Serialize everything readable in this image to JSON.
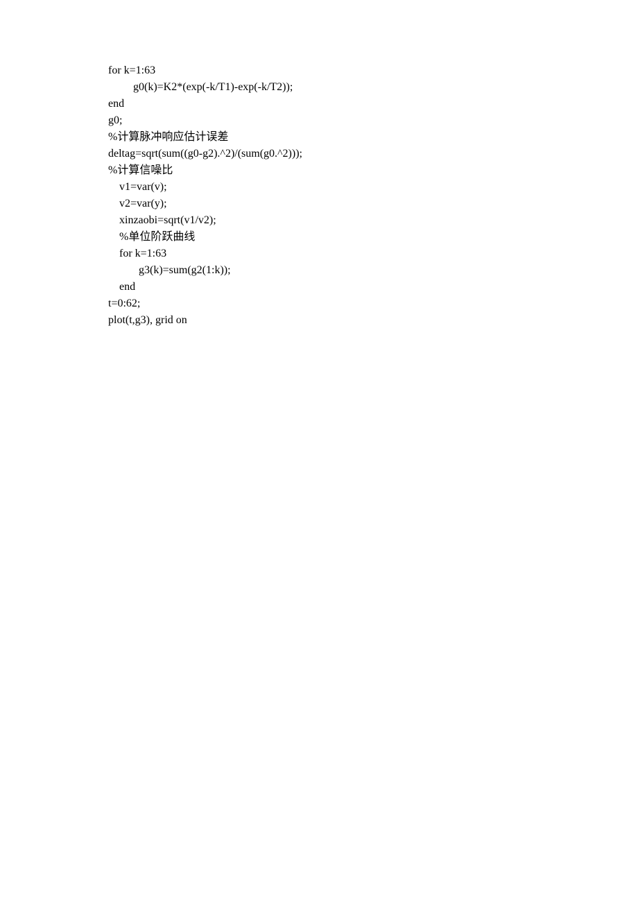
{
  "lines": [
    {
      "cls": "",
      "text": "for k=1:63"
    },
    {
      "cls": "indent1",
      "text": "g0(k)=K2*(exp(-k/T1)-exp(-k/T2));"
    },
    {
      "cls": "",
      "text": "end"
    },
    {
      "cls": "",
      "text": "g0;"
    },
    {
      "cls": "",
      "text": "%计算脉冲响应估计误差"
    },
    {
      "cls": "",
      "text": "deltag=sqrt(sum((g0-g2).^2)/(sum(g0.^2)));"
    },
    {
      "cls": "",
      "text": "%计算信噪比"
    },
    {
      "cls": "indent2",
      "text": "v1=var(v);"
    },
    {
      "cls": "indent2",
      "text": "v2=var(y);"
    },
    {
      "cls": "indent2",
      "text": "xinzaobi=sqrt(v1/v2);"
    },
    {
      "cls": "indent2",
      "text": "%单位阶跃曲线"
    },
    {
      "cls": "indent2",
      "text": "for k=1:63"
    },
    {
      "cls": "indent1",
      "text": "  g3(k)=sum(g2(1:k));"
    },
    {
      "cls": "indent2",
      "text": "end"
    },
    {
      "cls": "",
      "text": "t=0:62;"
    },
    {
      "cls": "",
      "text": "plot(t,g3), grid on"
    }
  ]
}
